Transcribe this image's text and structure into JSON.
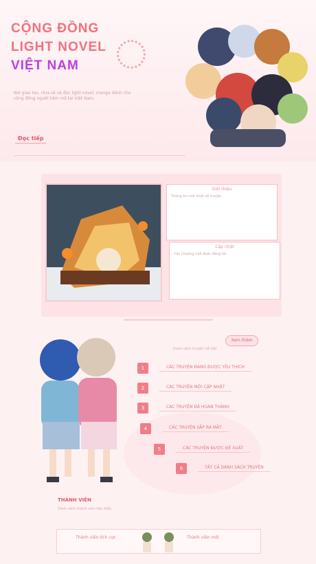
{
  "hero": {
    "title_line1": "CỘNG ĐỒNG",
    "title_line2": "LIGHT NOVEL",
    "title_line3": "VIỆT NAM",
    "intro": "Nơi giao lưu, chia sẻ và đọc light novel, manga dành cho cộng đồng người hâm mộ tại Việt Nam.",
    "more_link": "Đọc tiếp"
  },
  "card": {
    "panel1_title": "Giới thiệu",
    "panel1_text": "Thông tin mới nhất về truyện.",
    "panel2_title": "Cập nhật",
    "panel2_text": "Các chương mới được đăng tải."
  },
  "list": {
    "tag": "Xem thêm",
    "sub_note": "Danh sách truyện nổi bật",
    "items": [
      {
        "num": "1",
        "label": "CÁC TRUYỆN ĐANG ĐƯỢC YÊU THÍCH"
      },
      {
        "num": "2",
        "label": "CÁC TRUYỆN MỚI CẬP NHẬT"
      },
      {
        "num": "3",
        "label": "CÁC TRUYỆN ĐÃ HOÀN THÀNH"
      },
      {
        "num": "4",
        "label": "CÁC TRUYỆN SẮP RA MẮT"
      },
      {
        "num": "5",
        "label": "CÁC TRUYỆN ĐƯỢC ĐỀ XUẤT"
      },
      {
        "num": "6",
        "label": "TẤT CẢ DANH SÁCH TRUYỆN"
      }
    ]
  },
  "section2": {
    "title": "THÀNH VIÊN",
    "sub": "Danh sách thành viên tiêu biểu",
    "left_label": "Thành viên tích cực",
    "right_label": "Thành viên mới"
  },
  "colors": {
    "accent": "#f07e89",
    "purple": "#c13cdf"
  }
}
